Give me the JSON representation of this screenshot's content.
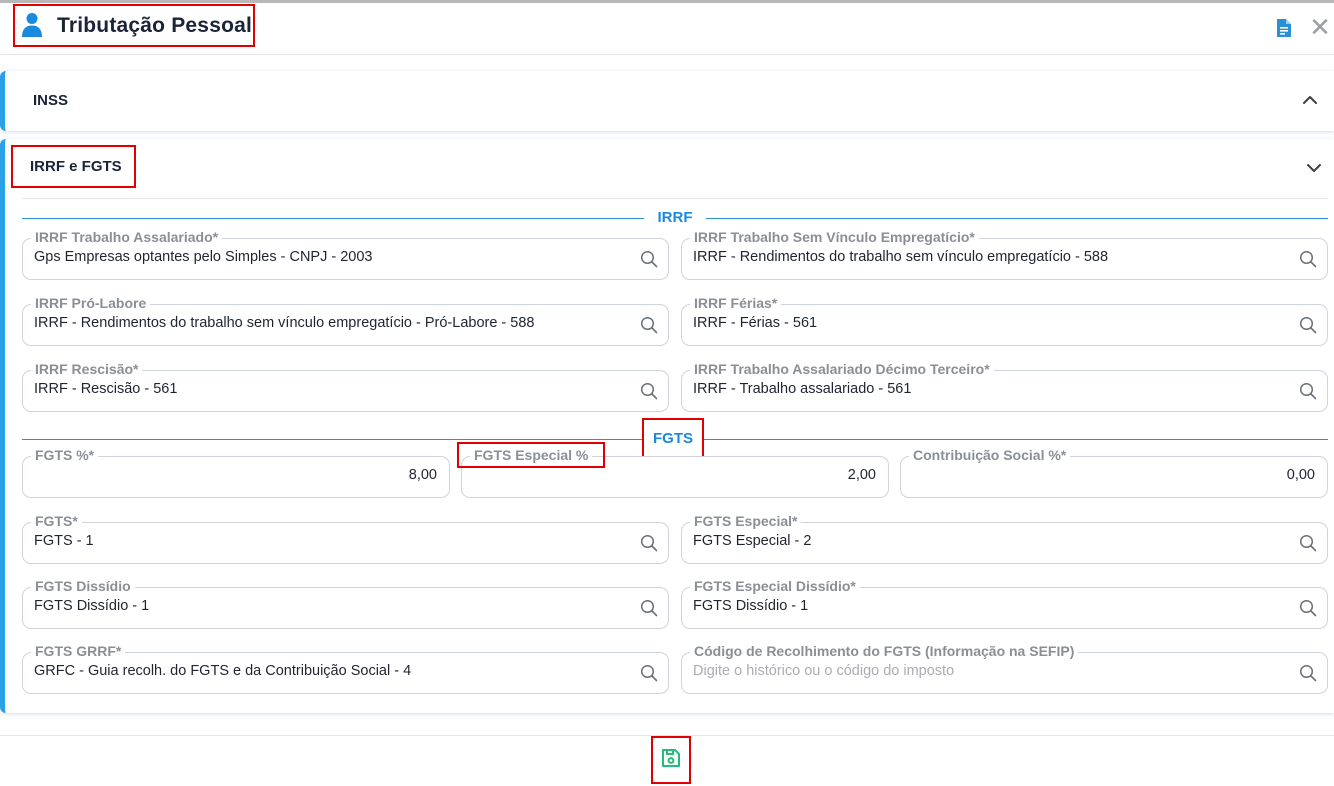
{
  "header": {
    "title": "Tributação Pessoal",
    "icons": {
      "person": "person-icon",
      "document": "document-icon",
      "close": "close-icon"
    },
    "close_glyph": "✕"
  },
  "colors": {
    "accent": "#2aa1e6",
    "section_label": "#1a8ae0",
    "highlight_border": "#e00000",
    "save_icon": "#1fbf7a"
  },
  "panels": {
    "inss": {
      "label": "INSS",
      "state": "expanded-chevron-up"
    },
    "irrf_fgts": {
      "label": "IRRF e FGTS",
      "state": "chevron-down"
    }
  },
  "sections": {
    "irrf": "IRRF",
    "fgts": "FGTS"
  },
  "irrf_fields": [
    {
      "label": "IRRF Trabalho Assalariado*",
      "value": "Gps Empresas optantes pelo Simples - CNPJ - 2003"
    },
    {
      "label": "IRRF Trabalho Sem Vínculo Empregatício*",
      "value": "IRRF - Rendimentos do trabalho sem vínculo empregatício - 588"
    },
    {
      "label": "IRRF Pró-Labore",
      "value": "IRRF - Rendimentos do trabalho sem vínculo empregatício - Pró-Labore - 588"
    },
    {
      "label": "IRRF Férias*",
      "value": "IRRF - Férias - 561"
    },
    {
      "label": "IRRF Rescisão*",
      "value": "IRRF - Rescisão - 561"
    },
    {
      "label": "IRRF Trabalho Assalariado Décimo Terceiro*",
      "value": "IRRF - Trabalho assalariado - 561"
    }
  ],
  "fgts_percent_fields": [
    {
      "label": "FGTS %*",
      "value": "8,00"
    },
    {
      "label": "FGTS Especial %",
      "value": "2,00"
    },
    {
      "label": "Contribuição Social %*",
      "value": "0,00"
    }
  ],
  "fgts_fields": [
    {
      "label": "FGTS*",
      "value": "FGTS - 1"
    },
    {
      "label": "FGTS Especial*",
      "value": "FGTS Especial - 2"
    },
    {
      "label": "FGTS Dissídio",
      "value": "FGTS Dissídio - 1"
    },
    {
      "label": "FGTS Especial Dissídio*",
      "value": "FGTS Dissídio - 1"
    },
    {
      "label": "FGTS GRRF*",
      "value": "GRFC - Guia recolh. do FGTS e da Contribuição Social - 4"
    },
    {
      "label": "Código de Recolhimento do FGTS (Informação na SEFIP)",
      "value": "",
      "placeholder": "Digite o histórico ou o código do imposto"
    }
  ],
  "footer": {
    "save_icon": "save-icon"
  }
}
